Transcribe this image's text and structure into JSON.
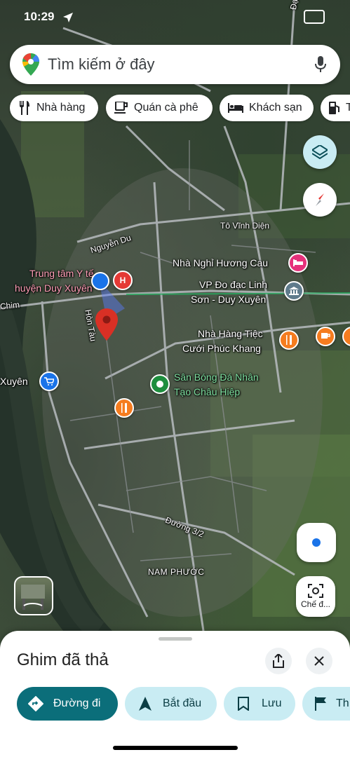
{
  "status_bar": {
    "time": "10:29"
  },
  "search": {
    "placeholder": "Tìm kiếm ở đây"
  },
  "chips": [
    {
      "label": "Nhà hàng",
      "icon": "fork-knife-icon"
    },
    {
      "label": "Quán cà phê",
      "icon": "coffee-cup-icon"
    },
    {
      "label": "Khách sạn",
      "icon": "bed-icon"
    },
    {
      "label": "T",
      "icon": "gas-station-icon"
    }
  ],
  "map_labels": {
    "dai_hanh": "Đại Hành",
    "to_vinh_dien": "Tô Vĩnh Diện",
    "nguyen_du": "Nguyễn Du",
    "trung_tam_line1": "Trung tâm Y tế",
    "trung_tam_line2": "huyện Duy Xuyên",
    "nha_nghi": "Nhà Nghỉ Hương Cau",
    "vp_line1": "VP Đo đạc Linh",
    "vp_line2": "Sơn - Duy Xuyên",
    "chim": "Chim",
    "hon_tau": "Hòn Tàu",
    "nha_hang_line1": "Nhà Hàng Tiệc",
    "nha_hang_line2": "Cưới Phúc Khang",
    "san_bong_line1": "Sân Bóng Đá Nhân",
    "san_bong_line2": "Tạo Châu Hiệp",
    "xuyen": "Xuyên",
    "duong_3_2": "Đường 3/2",
    "nam_phuoc": "NAM PHƯỚC",
    "hospital_letter": "H"
  },
  "map_controls": {
    "screenshot_label": "Chế đ..."
  },
  "sheet": {
    "title": "Ghim đã thả",
    "actions": [
      {
        "label": "Đường đi",
        "icon": "directions-icon"
      },
      {
        "label": "Bắt đầu",
        "icon": "navigation-arrow-icon"
      },
      {
        "label": "Lưu",
        "icon": "bookmark-icon"
      },
      {
        "label": "Th",
        "icon": "flag-icon"
      }
    ]
  },
  "colors": {
    "primary": "#0b6e7a",
    "action_bg": "#c9ecf3",
    "pin_red": "#d93025",
    "location_blue": "#1a73e8",
    "poi_orange": "#f57c1f",
    "poi_pink": "#e5317b",
    "poi_green": "#1e8e3e",
    "poi_gray": "#5f7b8c"
  }
}
